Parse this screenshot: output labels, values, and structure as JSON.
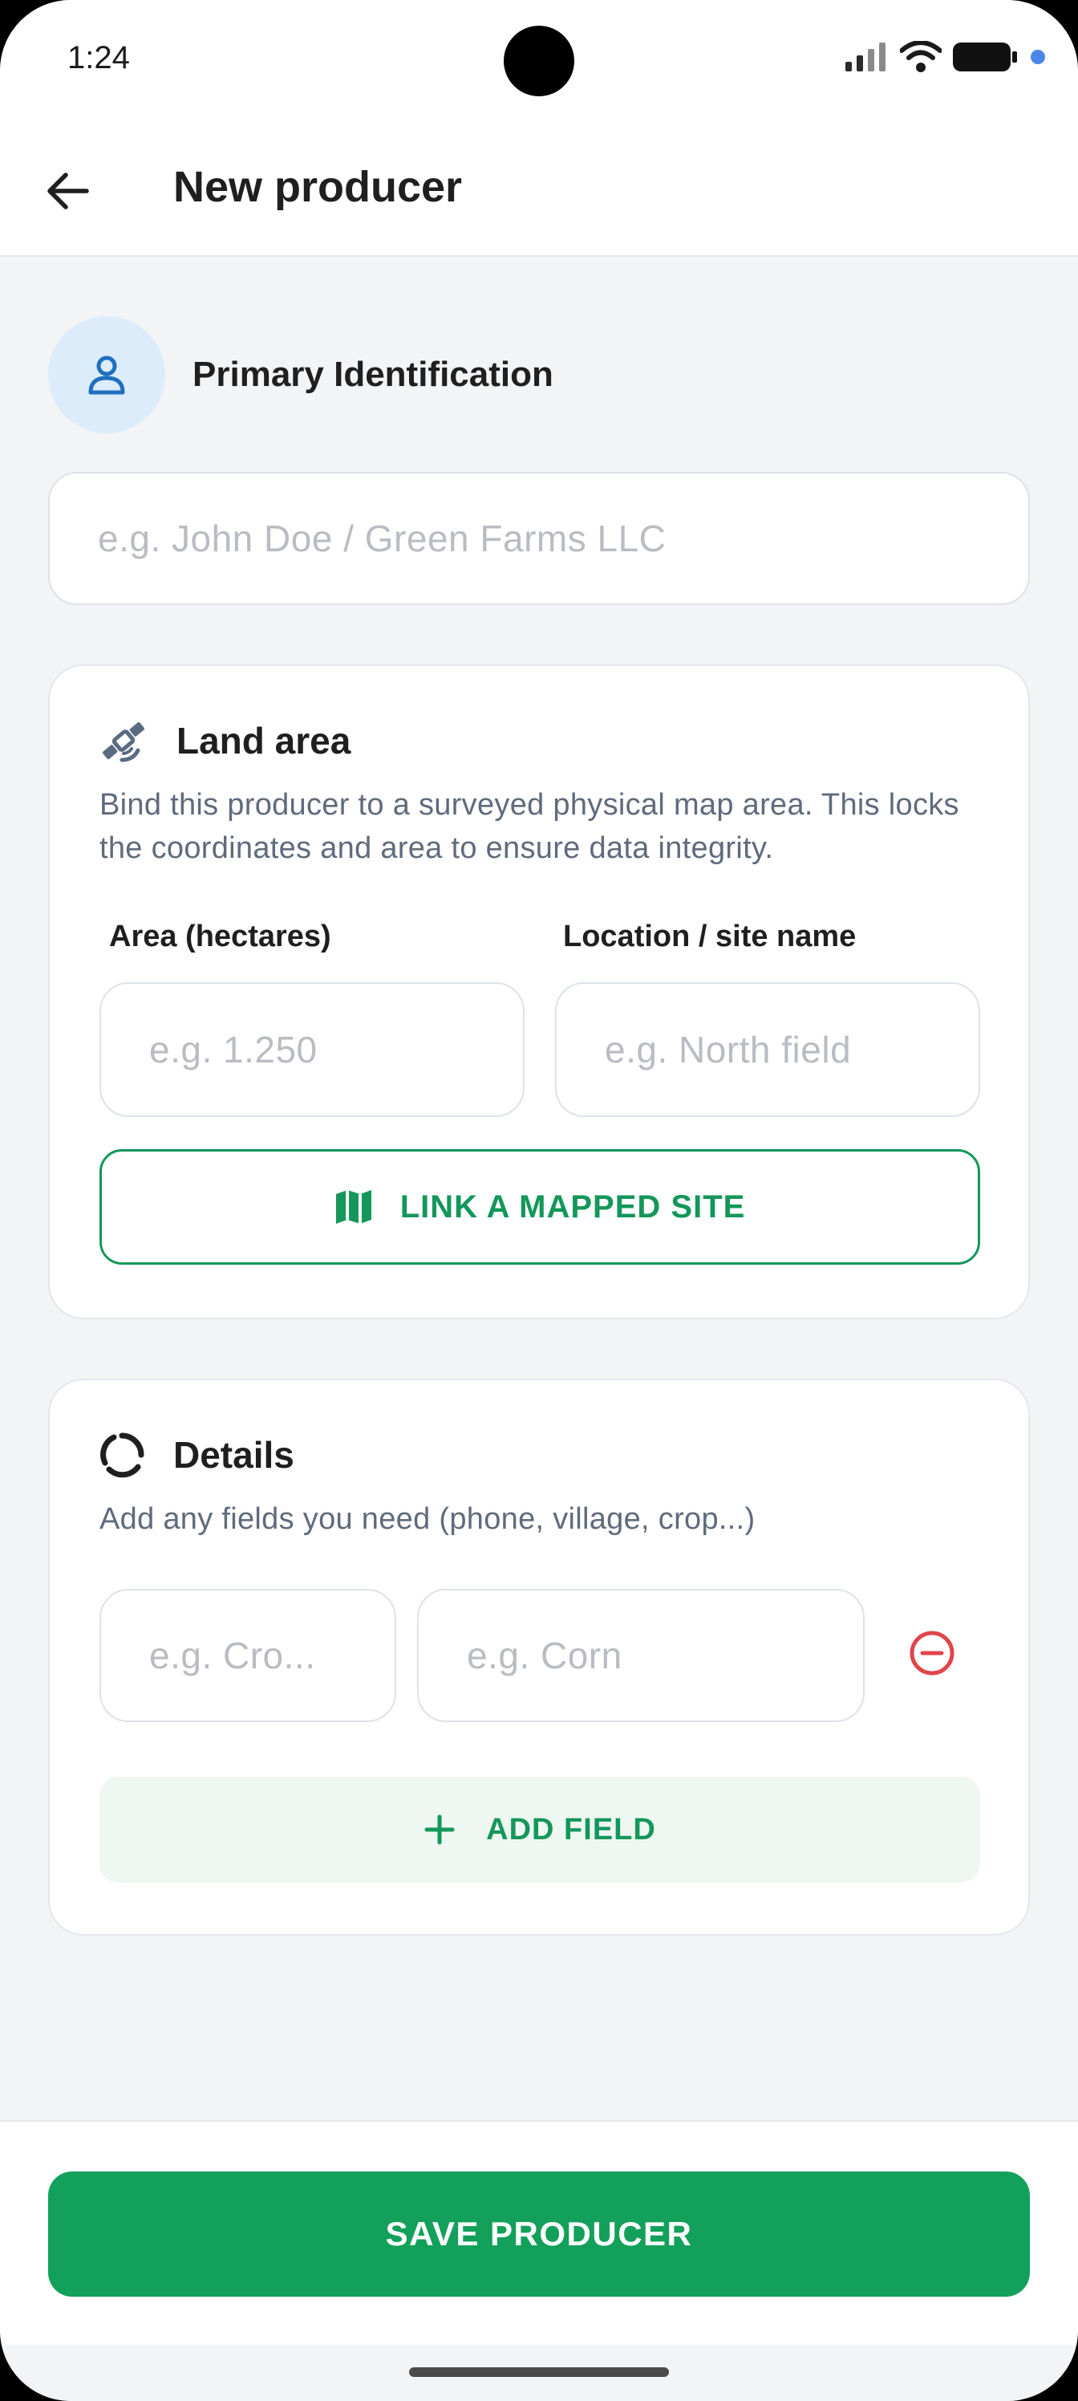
{
  "status_bar": {
    "time": "1:24"
  },
  "app_bar": {
    "title": "New producer",
    "back_icon": "arrow-left-icon"
  },
  "primary_identification": {
    "title": "Primary Identification",
    "icon": "person-icon",
    "name_placeholder": "e.g. John Doe / Green Farms LLC"
  },
  "land_area": {
    "title": "Land area",
    "icon": "satellite-icon",
    "description": "Bind this producer to a surveyed physical map area. This locks the coordinates and area to ensure data integrity.",
    "area_label": "Area (hectares)",
    "area_placeholder": "e.g. 1.250",
    "location_label": "Location / site name",
    "location_placeholder": "e.g. North field",
    "link_button_label": "LINK A MAPPED SITE",
    "link_button_icon": "map-icon"
  },
  "details": {
    "title": "Details",
    "icon": "progress-ring-icon",
    "description": "Add any fields you need (phone, village, crop...)",
    "fields": [
      {
        "key_placeholder": "e.g. Cro...",
        "value_placeholder": "e.g. Corn"
      }
    ],
    "remove_icon": "minus-circle-icon",
    "add_field_label": "ADD FIELD",
    "add_field_icon": "plus-icon"
  },
  "footer": {
    "save_label": "SAVE PRODUCER"
  },
  "colors": {
    "primary_green": "#13a05a",
    "accent_blue": "#1f6fbf",
    "remove_red": "#e0454a",
    "background": "#f3f4f6"
  }
}
